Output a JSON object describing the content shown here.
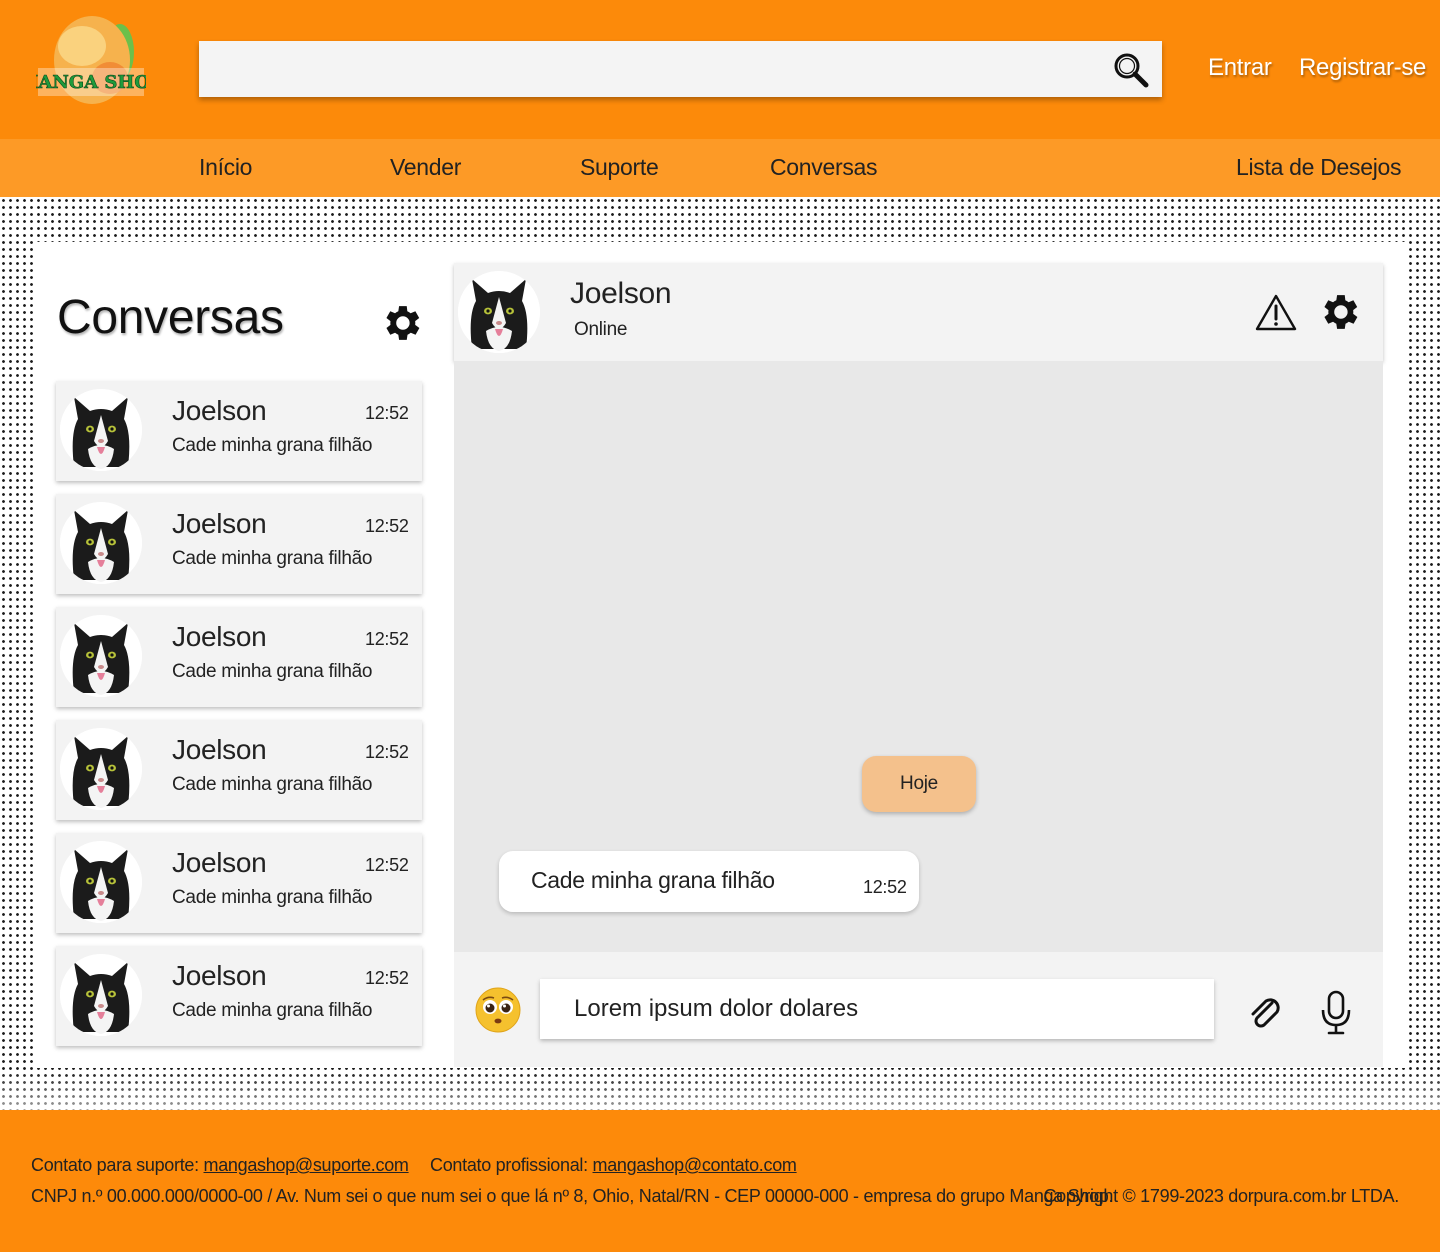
{
  "header": {
    "logo_text": "MANGA SHOP",
    "search_placeholder": "",
    "login_label": "Entrar",
    "register_label": "Registrar-se"
  },
  "nav": {
    "items": [
      {
        "label": "Início"
      },
      {
        "label": "Vender"
      },
      {
        "label": "Suporte"
      },
      {
        "label": "Conversas"
      },
      {
        "label": "Lista de Desejos"
      }
    ]
  },
  "sidebar": {
    "title": "Conversas",
    "conversations": [
      {
        "name": "Joelson",
        "time": "12:52",
        "preview": "Cade minha grana filhão"
      },
      {
        "name": "Joelson",
        "time": "12:52",
        "preview": "Cade minha grana filhão"
      },
      {
        "name": "Joelson",
        "time": "12:52",
        "preview": "Cade minha grana filhão"
      },
      {
        "name": "Joelson",
        "time": "12:52",
        "preview": "Cade minha grana filhão"
      },
      {
        "name": "Joelson",
        "time": "12:52",
        "preview": "Cade minha grana filhão"
      },
      {
        "name": "Joelson",
        "time": "12:52",
        "preview": "Cade minha grana filhão"
      }
    ]
  },
  "chat": {
    "contact_name": "Joelson",
    "contact_status": "Online",
    "day_separator": "Hoje",
    "messages": [
      {
        "text": "Cade minha grana filhão",
        "time": "12:52"
      }
    ],
    "input_value": "Lorem ipsum dolor dolares"
  },
  "footer": {
    "support_label": "Contato para suporte:",
    "support_email": "mangashop@suporte.com",
    "pro_label": "Contato profissional:",
    "pro_email": "mangashop@contato.com",
    "legal": "CNPJ n.º 00.000.000/0000-00 / Av. Num sei o que num sei o que lá nº 8, Ohio, Natal/RN - CEP 00000-000 - empresa do grupo Manga Shop.",
    "copyright": "Copyright © 1799-2023 dorpura.com.br LTDA."
  },
  "colors": {
    "primary_orange": "#fc8a0a",
    "nav_orange": "#fd9a26",
    "day_badge": "#f4c18c",
    "message_area": "#e8e8e8"
  },
  "icons": {
    "search": "magnifier-icon",
    "settings": "gear-icon",
    "report": "warning-triangle-icon",
    "emoji": "pleading-face-icon",
    "attach": "paperclip-icon",
    "mic": "microphone-icon"
  }
}
